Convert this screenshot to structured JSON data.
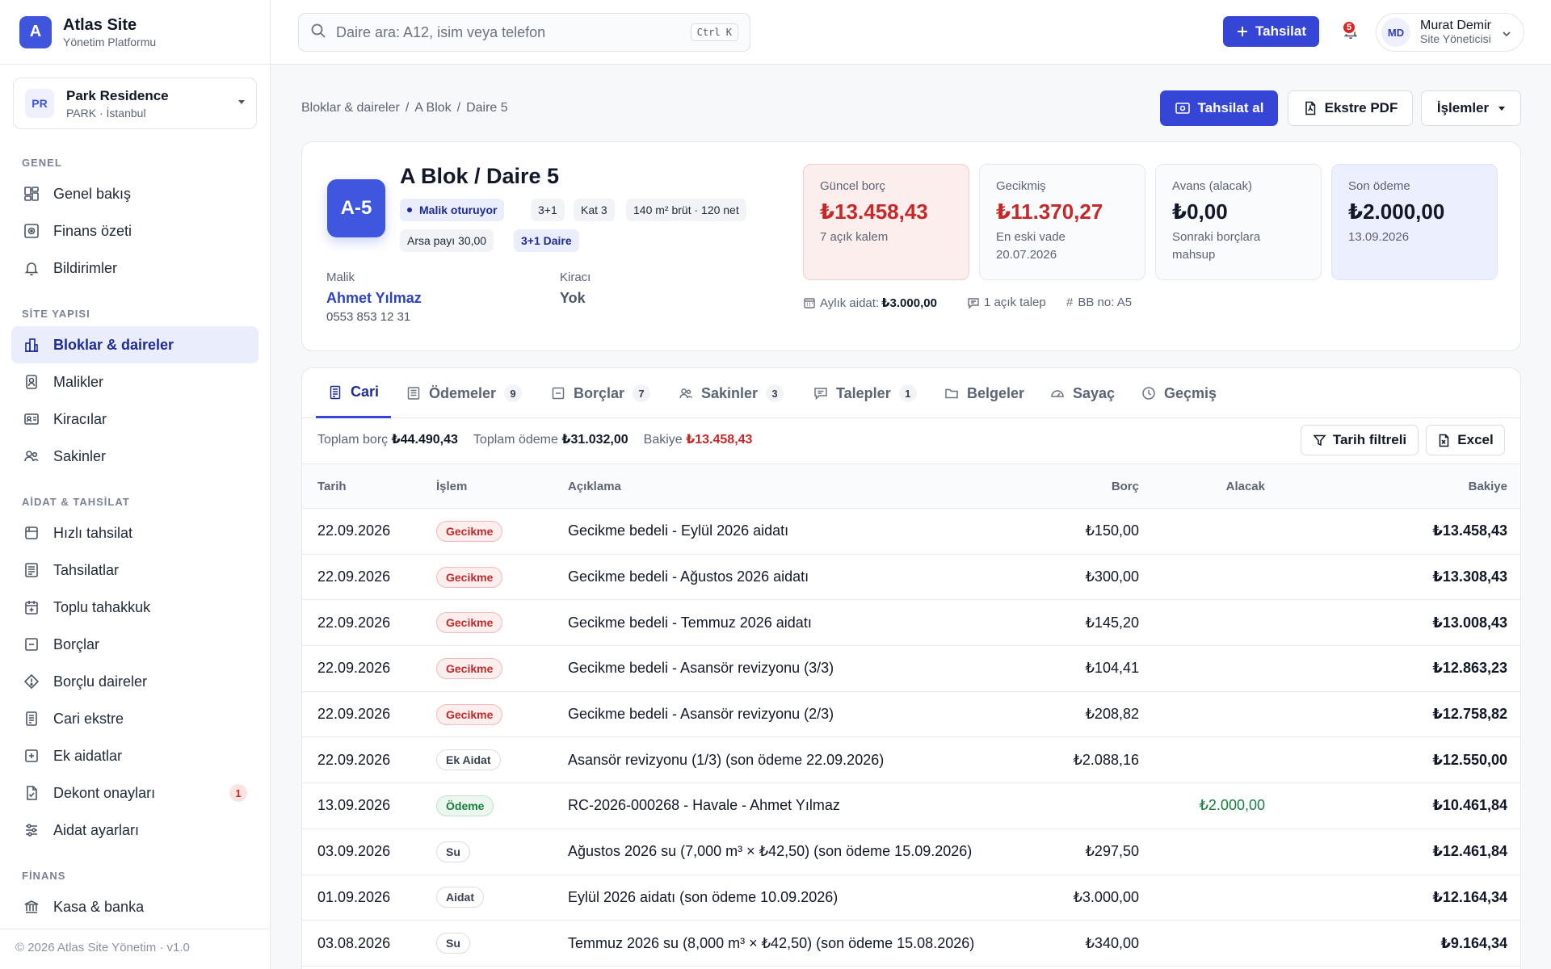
{
  "brand": {
    "logo": "A",
    "title": "Atlas Site",
    "subtitle": "Yönetim Platformu"
  },
  "site": {
    "badge": "PR",
    "name": "Park Residence",
    "sub": "PARK · İstanbul"
  },
  "sidebar": {
    "sections": [
      {
        "title": "GENEL",
        "items": [
          {
            "label": "Genel bakış",
            "icon": "layout-dashboard-icon"
          },
          {
            "label": "Finans özeti",
            "icon": "finance-icon"
          },
          {
            "label": "Bildirimler",
            "icon": "bell-icon"
          }
        ]
      },
      {
        "title": "SİTE YAPISI",
        "items": [
          {
            "label": "Bloklar & daireler",
            "icon": "building-icon",
            "active": true
          },
          {
            "label": "Malikler",
            "icon": "owner-icon"
          },
          {
            "label": "Kiracılar",
            "icon": "id-card-icon"
          },
          {
            "label": "Sakinler",
            "icon": "users-icon"
          }
        ]
      },
      {
        "title": "AİDAT & TAHSİLAT",
        "items": [
          {
            "label": "Hızlı tahsilat",
            "icon": "quick-pay-icon"
          },
          {
            "label": "Tahsilatlar",
            "icon": "receipt-icon"
          },
          {
            "label": "Toplu tahakkuk",
            "icon": "calendar-plus-icon"
          },
          {
            "label": "Borçlar",
            "icon": "minus-square-icon"
          },
          {
            "label": "Borçlu daireler",
            "icon": "alert-diamond-icon"
          },
          {
            "label": "Cari ekstre",
            "icon": "ledger-icon"
          },
          {
            "label": "Ek aidatlar",
            "icon": "plus-square-icon"
          },
          {
            "label": "Dekont onayları",
            "icon": "file-check-icon",
            "badge": "1"
          },
          {
            "label": "Aidat ayarları",
            "icon": "sliders-icon"
          }
        ]
      },
      {
        "title": "FİNANS",
        "items": [
          {
            "label": "Kasa & banka",
            "icon": "bank-icon"
          }
        ]
      }
    ],
    "footer": "© 2026 Atlas Site Yönetim · v1.0"
  },
  "topbar": {
    "search_placeholder": "Daire ara: A12, isim veya telefon",
    "shortcut": "Ctrl K",
    "primary_button": "Tahsilat",
    "notifications": "5",
    "user": {
      "initials": "MD",
      "name": "Murat Demir",
      "role": "Site Yöneticisi"
    }
  },
  "breadcrumb": [
    "Bloklar & daireler",
    "A Blok",
    "Daire 5"
  ],
  "actions": {
    "collect": "Tahsilat al",
    "pdf": "Ekstre PDF",
    "ops": "İşlemler"
  },
  "unit": {
    "badge": "A-5",
    "title": "A Blok / Daire 5",
    "chips": [
      "Malik oturuyor",
      "3+1",
      "Kat 3",
      "140 m² brüt · 120 net",
      "Arsa payı 30,00",
      "3+1 Daire"
    ],
    "owner_label": "Malik",
    "owner_name": "Ahmet Yılmaz",
    "owner_phone": "0553 853 12 31",
    "tenant_label": "Kiracı",
    "tenant_value": "Yok"
  },
  "stats": [
    {
      "label": "Güncel borç",
      "value": "₺13.458,43",
      "sub": "7 açık kalem"
    },
    {
      "label": "Gecikmiş",
      "value": "₺11.370,27",
      "sub": "En eski vade 20.07.2026"
    },
    {
      "label": "Avans (alacak)",
      "value": "₺0,00",
      "sub": "Sonraki borçlara mahsup"
    },
    {
      "label": "Son ödeme",
      "value": "₺2.000,00",
      "sub": "13.09.2026"
    }
  ],
  "meta": {
    "dues_label": "Aylık aidat:",
    "dues_value": "₺3.000,00",
    "requests": "1 açık talep",
    "bb": "BB no: A5"
  },
  "tabs": [
    {
      "label": "Cari",
      "icon": "ledger-icon",
      "active": true
    },
    {
      "label": "Ödemeler",
      "icon": "receipt-icon",
      "count": "9"
    },
    {
      "label": "Borçlar",
      "icon": "minus-square-icon",
      "count": "7"
    },
    {
      "label": "Sakinler",
      "icon": "users-icon",
      "count": "3"
    },
    {
      "label": "Talepler",
      "icon": "message-icon",
      "count": "1"
    },
    {
      "label": "Belgeler",
      "icon": "folder-icon"
    },
    {
      "label": "Sayaç",
      "icon": "gauge-icon"
    },
    {
      "label": "Geçmiş",
      "icon": "clock-icon"
    }
  ],
  "summary": {
    "total_debt_label": "Toplam borç",
    "total_debt": "₺44.490,43",
    "total_paid_label": "Toplam ödeme",
    "total_paid": "₺31.032,00",
    "balance_label": "Bakiye",
    "balance": "₺13.458,43"
  },
  "table_actions": {
    "filter": "Tarih filtreli",
    "excel": "Excel"
  },
  "table": {
    "columns": [
      "Tarih",
      "İşlem",
      "Açıklama",
      "Borç",
      "Alacak",
      "Bakiye"
    ],
    "rows": [
      {
        "date": "22.09.2026",
        "type": "Gecikme",
        "kind": "red",
        "desc": "Gecikme bedeli - Eylül 2026 aidatı",
        "debit": "₺150,00",
        "credit": "",
        "balance": "₺13.458,43"
      },
      {
        "date": "22.09.2026",
        "type": "Gecikme",
        "kind": "red",
        "desc": "Gecikme bedeli - Ağustos 2026 aidatı",
        "debit": "₺300,00",
        "credit": "",
        "balance": "₺13.308,43"
      },
      {
        "date": "22.09.2026",
        "type": "Gecikme",
        "kind": "red",
        "desc": "Gecikme bedeli - Temmuz 2026 aidatı",
        "debit": "₺145,20",
        "credit": "",
        "balance": "₺13.008,43"
      },
      {
        "date": "22.09.2026",
        "type": "Gecikme",
        "kind": "red",
        "desc": "Gecikme bedeli - Asansör revizyonu (3/3)",
        "debit": "₺104,41",
        "credit": "",
        "balance": "₺12.863,23"
      },
      {
        "date": "22.09.2026",
        "type": "Gecikme",
        "kind": "red",
        "desc": "Gecikme bedeli - Asansör revizyonu (2/3)",
        "debit": "₺208,82",
        "credit": "",
        "balance": "₺12.758,82"
      },
      {
        "date": "22.09.2026",
        "type": "Ek Aidat",
        "kind": "gray",
        "desc": "Asansör revizyonu (1/3) (son ödeme 22.09.2026)",
        "debit": "₺2.088,16",
        "credit": "",
        "balance": "₺12.550,00"
      },
      {
        "date": "13.09.2026",
        "type": "Ödeme",
        "kind": "green",
        "desc": "RC-2026-000268 - Havale - Ahmet Yılmaz",
        "debit": "",
        "credit": "₺2.000,00",
        "balance": "₺10.461,84"
      },
      {
        "date": "03.09.2026",
        "type": "Su",
        "kind": "gray",
        "desc": "Ağustos 2026 su (7,000 m³ × ₺42,50) (son ödeme 15.09.2026)",
        "debit": "₺297,50",
        "credit": "",
        "balance": "₺12.461,84"
      },
      {
        "date": "01.09.2026",
        "type": "Aidat",
        "kind": "gray",
        "desc": "Eylül 2026 aidatı (son ödeme 10.09.2026)",
        "debit": "₺3.000,00",
        "credit": "",
        "balance": "₺12.164,34"
      },
      {
        "date": "03.08.2026",
        "type": "Su",
        "kind": "gray",
        "desc": "Temmuz 2026 su (8,000 m³ × ₺42,50) (son ödeme 15.08.2026)",
        "debit": "₺340,00",
        "credit": "",
        "balance": "₺9.164,34"
      }
    ]
  }
}
